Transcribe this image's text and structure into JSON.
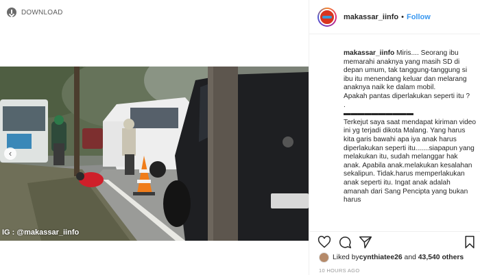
{
  "download": {
    "label": "DOWNLOAD"
  },
  "video": {
    "watermark": "IG : @makassar_iinfo"
  },
  "post": {
    "username": "makassar_iinfo",
    "follow_label": "Follow",
    "separator": "•",
    "caption_user": "makassar_iinfo",
    "caption_text": " Miris.... Seorang ibu memarahi anaknya yang masih SD di depan umum, tak tanggung-tanggung si ibu itu menendang keluar dan melarang anaknya naik ke dalam mobil.\nApakah pantas diperlakukan seperti itu ?\n.\n▬▬▬▬▬▬▬▬▬▬\nTerkejut saya saat mendapat kiriman video ini yg terjadi dikota Malang. Yang harus kita garis bawahi apa iya anak harus diperlakukan seperti itu.......siapapun yang melakukan itu, sudah melanggar hak anak. Apabila anak.melakukan kesalahan sekalipun. Tidak.harus memperlakukan anak seperti itu. Ingat anak adalah amanah dari Sang Pencipta yang bukan harus",
    "liked_by_label": "Liked by ",
    "liked_by_user": "cynthiatee26",
    "and_label": " and ",
    "others": "43,540 others",
    "time": "10 HOURS AGO"
  },
  "colors": {
    "link": "#3897f0",
    "text": "#262626",
    "muted": "#999999"
  },
  "icons": [
    "download-icon",
    "heart-icon",
    "comment-icon",
    "share-icon",
    "bookmark-icon"
  ]
}
